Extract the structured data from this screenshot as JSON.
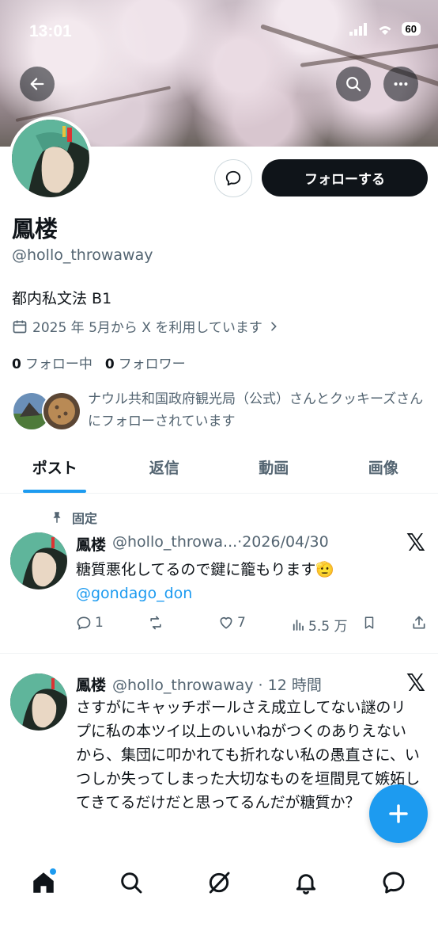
{
  "status_bar": {
    "time": "13:01",
    "battery": "60"
  },
  "profile": {
    "display_name": "鳳楼",
    "handle": "@hollo_throwaway",
    "bio": "都内私文法 B1",
    "joined": "2025 年 5月から X を利用しています",
    "following_count": "0",
    "following_label": "フォロー中",
    "followers_count": "0",
    "followers_label": "フォロワー",
    "followed_by_text": "ナウル共和国政府観光局（公式）さんとクッキーズさんにフォローされています",
    "follow_button": "フォローする"
  },
  "tabs": [
    "ポスト",
    "返信",
    "動画",
    "画像"
  ],
  "posts": [
    {
      "pinned_label": "固定",
      "name": "鳳楼",
      "meta": "@hollo_throwa...·2026/04/30",
      "text": "糖質悪化してるので鍵に籠もります🫡",
      "mention": "@gondago_don",
      "replies": "1",
      "reposts": "",
      "likes": "7",
      "views": "5.5 万"
    },
    {
      "name": "鳳楼",
      "meta": "@hollo_throwaway · 12 時間",
      "text": "さすがにキャッチボールさえ成立してない謎のリプに私の本ツイ以上のいいねがつくのありえないから、集団に叩かれても折れない私の愚直さに、いつしか失ってしまった大切なものを垣間見て嫉妬してきてるだけだと思ってるんだが糖質か？"
    }
  ],
  "icons": {
    "back": "arrow-left-icon",
    "search": "search-icon",
    "more": "more-icon",
    "message": "message-icon",
    "calendar": "calendar-icon",
    "pin": "pin-icon",
    "x_logo": "x-logo-icon",
    "compose": "plus-icon"
  },
  "colors": {
    "accent": "#1d9bf0",
    "text": "#0f1419",
    "muted": "#536471"
  }
}
